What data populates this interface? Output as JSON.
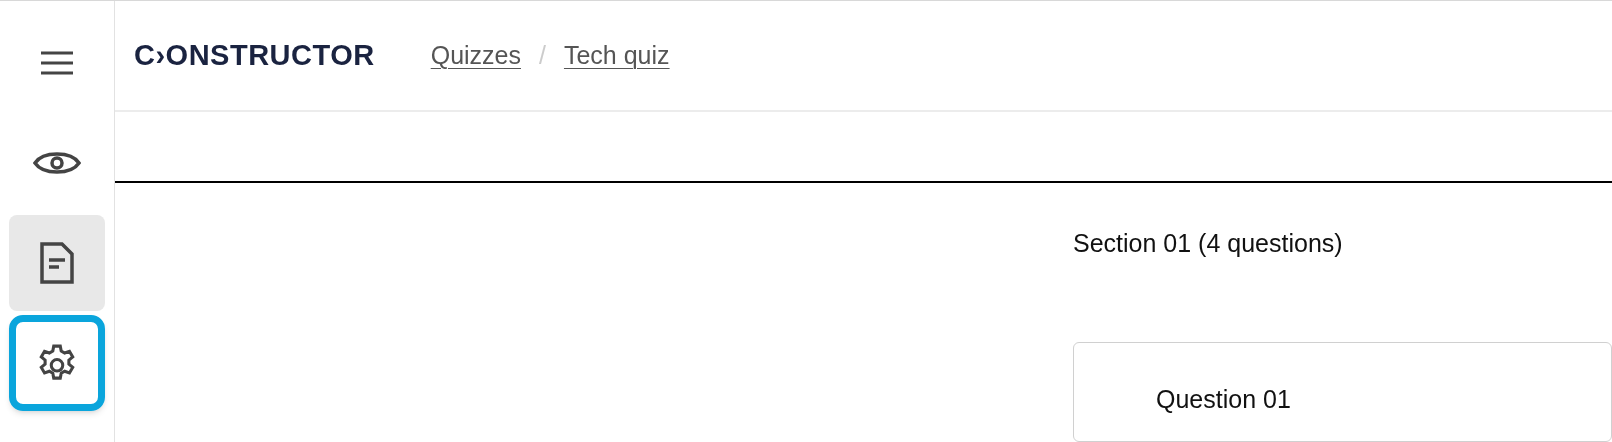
{
  "sidebar": {
    "items": [
      {
        "kind": "menu",
        "selected": false,
        "focused": false
      },
      {
        "kind": "preview",
        "selected": false,
        "focused": false
      },
      {
        "kind": "document",
        "selected": true,
        "focused": false
      },
      {
        "kind": "settings",
        "selected": false,
        "focused": true
      }
    ]
  },
  "header": {
    "logo": "C›ONSTRUCTOR",
    "breadcrumbs": [
      {
        "label": "Quizzes"
      },
      {
        "label": "Tech quiz"
      }
    ],
    "separator": "/"
  },
  "section": {
    "title": "Section 01 (4 questions)",
    "questions": [
      {
        "title": "Question 01"
      }
    ]
  }
}
